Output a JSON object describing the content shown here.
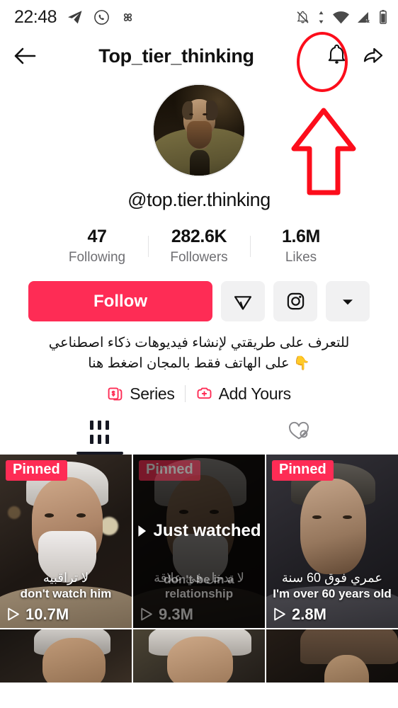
{
  "status_bar": {
    "time": "22:48",
    "left_icons": [
      "telegram-icon",
      "whatsapp-icon",
      "pinwheel-icon"
    ],
    "right_icons": [
      "notifications-off-icon",
      "data-transfer-icon",
      "wifi-icon",
      "cellular-off-icon",
      "battery-icon"
    ]
  },
  "header": {
    "back_icon": "back-arrow-icon",
    "title": "Top_tier_thinking",
    "bell_icon": "notification-bell-icon",
    "share_icon": "share-arrow-icon"
  },
  "annotation": {
    "ellipse_target": "notification-bell-icon",
    "arrow_direction": "up",
    "color": "#fc0d1b"
  },
  "profile": {
    "avatar_alt": "portrait-painting-avatar",
    "handle": "@top.tier.thinking",
    "stats": [
      {
        "value": "47",
        "label": "Following"
      },
      {
        "value": "282.6K",
        "label": "Followers"
      },
      {
        "value": "1.6M",
        "label": "Likes"
      }
    ],
    "bio_line1": "للتعرف على طريقتي لإنشاء فيديوهات ذكاء اصطناعي",
    "bio_line2": "على الهاتف فقط بالمجان اضغط هنا",
    "bio_emoji": "👇"
  },
  "actions": {
    "follow_label": "Follow",
    "follow_color": "#fe2c55",
    "message_icon": "send-message-icon",
    "instagram_icon": "instagram-icon",
    "more_icon": "chevron-down-icon"
  },
  "links": {
    "series_label": "Series",
    "series_icon": "series-cards-icon",
    "add_yours_label": "Add Yours",
    "add_yours_icon": "add-yours-camera-icon",
    "accent_color": "#fe2c55"
  },
  "tabs": [
    {
      "name": "videos",
      "icon": "grid-videos-icon",
      "active": true
    },
    {
      "name": "liked-private",
      "icon": "heart-hidden-icon",
      "active": false
    }
  ],
  "videos": [
    {
      "badge": "Pinned",
      "caption_ar": "لا تراقبيه",
      "caption_en": "don't watch him",
      "views": "10.7M",
      "watched": false,
      "theme": "beige-jacket-white-beard"
    },
    {
      "badge": "Pinned",
      "caption_ar": "لا تدخل في علاقة",
      "caption_en": "don't be in a relationship",
      "views": "9.3M",
      "watched": true,
      "watched_label": "Just watched",
      "theme": "dark-wild-hair"
    },
    {
      "badge": "Pinned",
      "caption_ar": "عمري فوق 60 سنة",
      "caption_en": "I'm over 60 years old",
      "views": "2.8M",
      "watched": false,
      "theme": "wrinkled-grey-coat"
    }
  ],
  "videos_row2": [
    {
      "theme": "silver-hair-dark-bg"
    },
    {
      "theme": "silver-wavy-hair-bright"
    },
    {
      "theme": "cowboy-hat"
    }
  ]
}
